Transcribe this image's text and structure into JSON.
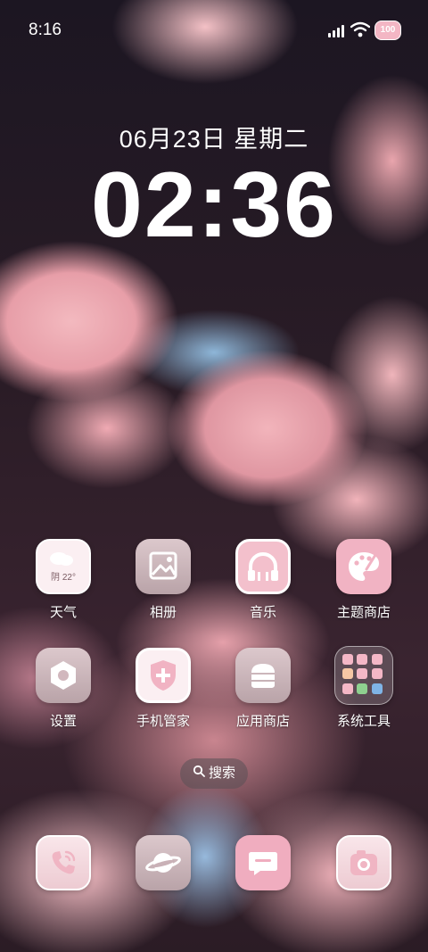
{
  "status_bar": {
    "time": "8:16",
    "battery": "100"
  },
  "lock": {
    "date": "06月23日 星期二",
    "time": "02:36"
  },
  "apps": [
    {
      "label": "天气",
      "weather_text": "阴 22°"
    },
    {
      "label": "相册"
    },
    {
      "label": "音乐"
    },
    {
      "label": "主题商店"
    },
    {
      "label": "设置"
    },
    {
      "label": "手机管家"
    },
    {
      "label": "应用商店"
    },
    {
      "label": "系统工具"
    }
  ],
  "search": {
    "label": "搜索"
  },
  "dock": [
    {
      "icon": "phone-icon"
    },
    {
      "icon": "browser-planet-icon"
    },
    {
      "icon": "message-icon"
    },
    {
      "icon": "camera-icon"
    }
  ],
  "colors": {
    "accent_pink": "#f1b7c5",
    "icon_glyph": "#ffffff"
  }
}
